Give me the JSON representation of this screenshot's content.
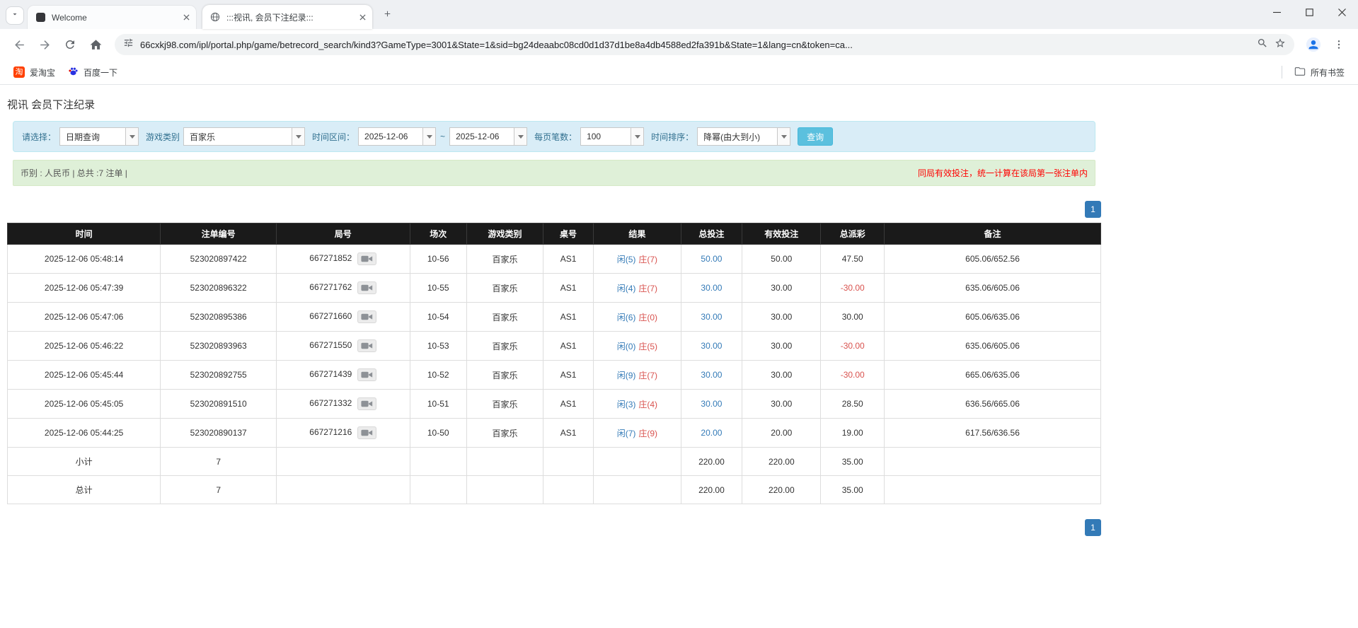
{
  "colors": {
    "link_blue": "#337ab7",
    "result_player_blue": "#337ab7",
    "result_banker_red": "#d9534f",
    "negative_red": "#d9534f",
    "warning_red": "#ff0000",
    "search_button_cyan": "#5bc0de",
    "table_header_black": "#1a1a1a",
    "summary_gray": "#9d9d9d",
    "filter_panel_bg": "#d9edf7",
    "info_bar_bg": "#dff0d8"
  },
  "browser": {
    "tabs": [
      {
        "title": "Welcome"
      },
      {
        "title": ":::视讯, 会员下注纪录:::"
      }
    ],
    "url": "66cxkj98.com/ipl/portal.php/game/betrecord_search/kind3?GameType=3001&State=1&sid=bg24deaabc08cd0d1d37d1be8a4db4588ed2fa391b&State=1&lang=cn&token=ca...",
    "bookmarks": {
      "taobao_icon_char": "淘",
      "taobao": "爱淘宝",
      "baidu": "百度一下",
      "all_bookmarks": "所有书签"
    }
  },
  "page": {
    "title": "视讯 会员下注纪录",
    "filters": {
      "select_label": "请选择：",
      "select_value": "日期查询",
      "game_type_label": "游戏类别",
      "game_type_value": "百家乐",
      "date_range_label": "时间区间：",
      "date_from": "2025-12-06",
      "date_separator": "~",
      "date_to": "2025-12-06",
      "page_size_label": "每页笔数：",
      "page_size_value": "100",
      "sort_label": "时间排序：",
      "sort_value": "降幂(由大到小)",
      "search_button": "查询"
    },
    "info_bar": {
      "left": "币别 : 人民币 | 总共 :7 注单 |",
      "right": "同局有效投注，统一计算在该局第一张注单内"
    },
    "pagination": {
      "page": "1"
    },
    "table": {
      "headers": [
        "时间",
        "注单编号",
        "局号",
        "场次",
        "游戏类别",
        "桌号",
        "结果",
        "总投注",
        "有效投注",
        "总派彩",
        "备注"
      ],
      "rows": [
        {
          "time": "2025-12-06 05:48:14",
          "bet_no": "523020897422",
          "round_no": "667271852",
          "session": "10-56",
          "game": "百家乐",
          "table_no": "AS1",
          "result_player": "闲(5)",
          "result_banker": "庄(7)",
          "total_bet": "50.00",
          "valid_bet": "50.00",
          "payout": "47.50",
          "note": "605.06/652.56"
        },
        {
          "time": "2025-12-06 05:47:39",
          "bet_no": "523020896322",
          "round_no": "667271762",
          "session": "10-55",
          "game": "百家乐",
          "table_no": "AS1",
          "result_player": "闲(4)",
          "result_banker": "庄(7)",
          "total_bet": "30.00",
          "valid_bet": "30.00",
          "payout": "-30.00",
          "note": "635.06/605.06"
        },
        {
          "time": "2025-12-06 05:47:06",
          "bet_no": "523020895386",
          "round_no": "667271660",
          "session": "10-54",
          "game": "百家乐",
          "table_no": "AS1",
          "result_player": "闲(6)",
          "result_banker": "庄(0)",
          "total_bet": "30.00",
          "valid_bet": "30.00",
          "payout": "30.00",
          "note": "605.06/635.06"
        },
        {
          "time": "2025-12-06 05:46:22",
          "bet_no": "523020893963",
          "round_no": "667271550",
          "session": "10-53",
          "game": "百家乐",
          "table_no": "AS1",
          "result_player": "闲(0)",
          "result_banker": "庄(5)",
          "total_bet": "30.00",
          "valid_bet": "30.00",
          "payout": "-30.00",
          "note": "635.06/605.06"
        },
        {
          "time": "2025-12-06 05:45:44",
          "bet_no": "523020892755",
          "round_no": "667271439",
          "session": "10-52",
          "game": "百家乐",
          "table_no": "AS1",
          "result_player": "闲(9)",
          "result_banker": "庄(7)",
          "total_bet": "30.00",
          "valid_bet": "30.00",
          "payout": "-30.00",
          "note": "665.06/635.06"
        },
        {
          "time": "2025-12-06 05:45:05",
          "bet_no": "523020891510",
          "round_no": "667271332",
          "session": "10-51",
          "game": "百家乐",
          "table_no": "AS1",
          "result_player": "闲(3)",
          "result_banker": "庄(4)",
          "total_bet": "30.00",
          "valid_bet": "30.00",
          "payout": "28.50",
          "note": "636.56/665.06"
        },
        {
          "time": "2025-12-06 05:44:25",
          "bet_no": "523020890137",
          "round_no": "667271216",
          "session": "10-50",
          "game": "百家乐",
          "table_no": "AS1",
          "result_player": "闲(7)",
          "result_banker": "庄(9)",
          "total_bet": "20.00",
          "valid_bet": "20.00",
          "payout": "19.00",
          "note": "617.56/636.56"
        }
      ],
      "subtotal": {
        "label": "小计",
        "count": "7",
        "total_bet": "220.00",
        "valid_bet": "220.00",
        "payout": "35.00"
      },
      "total": {
        "label": "总计",
        "count": "7",
        "total_bet": "220.00",
        "valid_bet": "220.00",
        "payout": "35.00"
      }
    }
  }
}
